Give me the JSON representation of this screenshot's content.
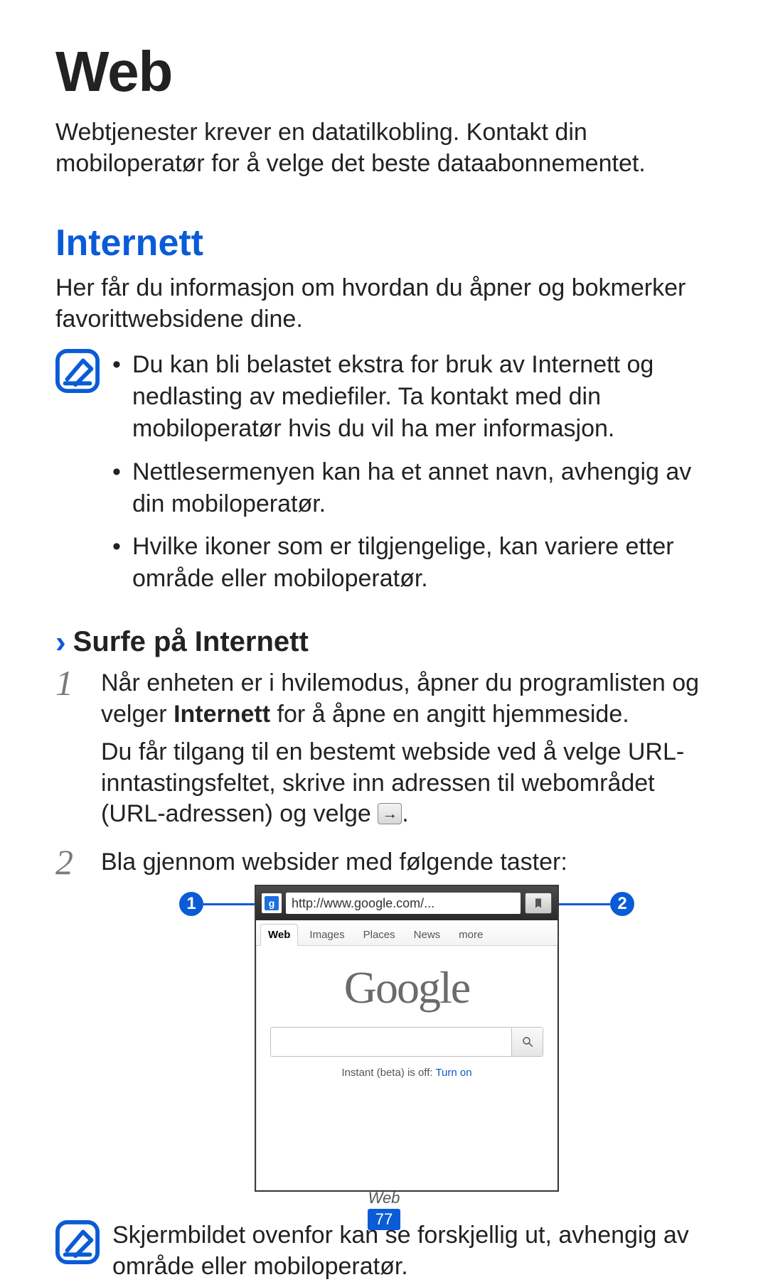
{
  "title": "Web",
  "intro": "Webtjenester krever en datatilkobling. Kontakt din mobiloperatør for å velge det beste dataabonnementet.",
  "section": {
    "heading": "Internett",
    "p": "Her får du informasjon om hvordan du åpner og bokmerker favorittwebsidene dine."
  },
  "note1": {
    "bullets": [
      "Du kan bli belastet ekstra for bruk av Internett og nedlasting av mediefiler. Ta kontakt med din mobiloperatør hvis du vil ha mer informasjon.",
      "Nettlesermenyen kan ha et annet navn, avhengig av din mobiloperatør.",
      "Hvilke ikoner som er tilgjengelige, kan variere etter område eller mobiloperatør."
    ]
  },
  "sub": {
    "heading": "Surfe på Internett"
  },
  "steps": {
    "s1": {
      "num": "1",
      "pre": "Når enheten er i hvilemodus, åpner du programlisten og velger ",
      "bold": "Internett",
      "post": " for å åpne en angitt hjemmeside.",
      "p2a": "Du får tilgang til en bestemt webside ved å velge URL-inntastingsfeltet, skrive inn adressen til webområdet (URL-adressen) og velge ",
      "p2b": "."
    },
    "s2": {
      "num": "2",
      "text": "Bla gjennom websider med følgende taster:"
    }
  },
  "callouts": {
    "one": "1",
    "two": "2"
  },
  "browser": {
    "url": "http://www.google.com/...",
    "tabs": {
      "web": "Web",
      "images": "Images",
      "places": "Places",
      "news": "News",
      "more": "more"
    },
    "logo": "Google",
    "instant_pre": "Instant (beta) is off: ",
    "instant_link": "Turn on"
  },
  "note2": {
    "text": "Skjermbildet ovenfor kan se forskjellig ut, avhengig av område eller mobiloperatør."
  },
  "footer": {
    "section": "Web",
    "page": "77"
  }
}
